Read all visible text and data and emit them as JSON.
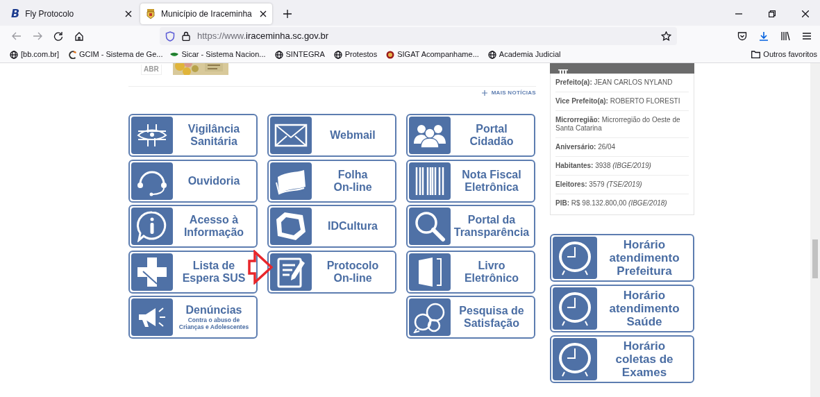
{
  "browser": {
    "tabs": [
      {
        "favicon_text": "B",
        "title": "Fly Protocolo",
        "selected": false
      },
      {
        "title": "Município de Iraceminha",
        "selected": true
      }
    ],
    "address": {
      "scheme_part": "https://www.",
      "domain": "iraceminha.sc.gov.br"
    },
    "bookmarks": [
      {
        "label": "[bb.com.br]"
      },
      {
        "label": "GCIM - Sistema de Ge..."
      },
      {
        "label": "Sicar - Sistema Nacion..."
      },
      {
        "label": "SINTEGRA"
      },
      {
        "label": "Protestos"
      },
      {
        "label": "SIGAT Acompanhame..."
      },
      {
        "label": "Academia Judicial"
      }
    ],
    "other_bookmarks": "Outros favoritos"
  },
  "news": {
    "month": "ABR",
    "more_link": "MAIS NOTÍCIAS"
  },
  "service_columns": [
    [
      {
        "label": "Vigilância\nSanitária"
      },
      {
        "label": "Ouvidoria"
      },
      {
        "label": "Acesso à\nInformação"
      },
      {
        "label": "Lista de\nEspera SUS"
      },
      {
        "label": "Denúncias",
        "subtitle": "Contra o abuso de\nCrianças e Adolescentes"
      }
    ],
    [
      {
        "label": "Webmail"
      },
      {
        "label": "Folha\nOn-line"
      },
      {
        "label": "IDCultura"
      },
      {
        "label": "Protocolo\nOn-line"
      }
    ],
    [
      {
        "label": "Portal\nCidadão"
      },
      {
        "label": "Nota Fiscal\nEletrônica"
      },
      {
        "label": "Portal da\nTransparência"
      },
      {
        "label": "Livro\nEletrônico"
      },
      {
        "label": "Pesquisa de\nSatisfação"
      }
    ]
  ],
  "municipal_info": [
    "**Prefeito(a):** JEAN CARLOS NYLAND",
    "**Vice Prefeito(a):** ROBERTO FLORESTI",
    "**Microrregião:** Microrregião do Oeste de Santa Catarina",
    "**Aniversário:** 26/04",
    "**Habitantes:** 3938 *(IBGE/2019)*",
    "**Eleitores:** 3579 *(TSE/2019)*",
    "**PIB:** R$ 98.132.800,00 *(IBGE/2018)*"
  ],
  "schedule_tiles": [
    {
      "label": "Horário\natendimento\nPrefeitura"
    },
    {
      "label": "Horário\natendimento\nSaúde"
    },
    {
      "label": "Horário\ncoletas de\nExames"
    }
  ]
}
